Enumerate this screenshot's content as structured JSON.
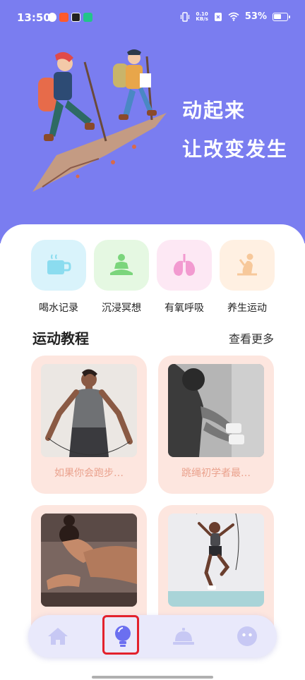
{
  "status_bar": {
    "time": "13:50",
    "net_speed_value": "0.10",
    "net_speed_unit": "KB/s",
    "battery_percent": "53%"
  },
  "hero": {
    "line1": "动起来",
    "line2": "让改变发生"
  },
  "quick_actions": [
    {
      "label": "喝水记录",
      "icon": "cup-icon",
      "tile_color": "#d9f3fb"
    },
    {
      "label": "沉浸冥想",
      "icon": "meditation-icon",
      "tile_color": "#e5f8e2"
    },
    {
      "label": "有氧呼吸",
      "icon": "lungs-icon",
      "tile_color": "#fde8f4"
    },
    {
      "label": "养生运动",
      "icon": "yoga-icon",
      "tile_color": "#fff0e2"
    }
  ],
  "section": {
    "title": "运动教程",
    "more": "查看更多"
  },
  "tutorials": [
    {
      "title": "如果你会跑步…"
    },
    {
      "title": "跳绳初学者最…"
    },
    {
      "title": ""
    },
    {
      "title": ""
    }
  ],
  "bottom_nav": [
    {
      "icon": "home-icon"
    },
    {
      "icon": "lightbulb-icon",
      "selected": true
    },
    {
      "icon": "service-bell-icon"
    },
    {
      "icon": "face-icon"
    }
  ],
  "colors": {
    "hero_bg": "#7a7df0",
    "card_bg": "#fde6df",
    "nav_bg": "#e9e9fb",
    "accent": "#6b6ff0",
    "highlight": "#e3222c"
  }
}
